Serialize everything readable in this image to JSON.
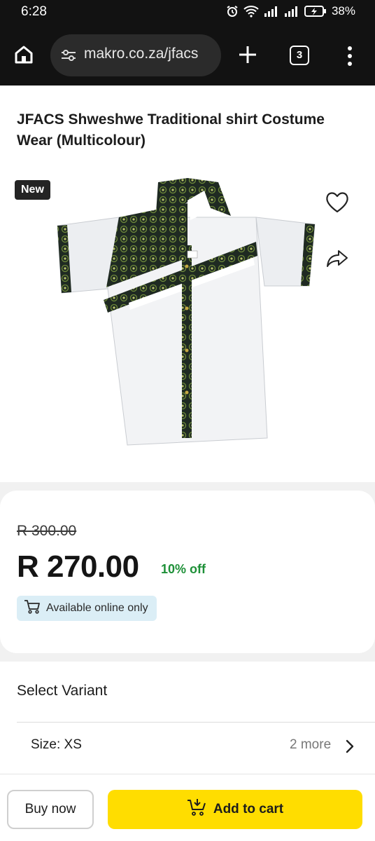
{
  "status_bar": {
    "time": "6:28",
    "battery": "38%",
    "icons": [
      "alarm-icon",
      "wifi-icon",
      "signal-icon",
      "signal-icon",
      "battery-charging-icon"
    ]
  },
  "browser": {
    "url": "makro.co.za/jfacs",
    "tab_count": "3",
    "icons": [
      "home-icon",
      "site-settings-icon",
      "plus-icon",
      "more-vertical-icon"
    ]
  },
  "product": {
    "title": "JFACS Shweshwe Traditional shirt Costume Wear (Multicolour)",
    "badge": "New",
    "old_price": "R 300.00",
    "price": "R 270.00",
    "discount": "10% off",
    "availability": "Available online only",
    "icons": [
      "heart-icon",
      "share-icon",
      "cart-icon"
    ]
  },
  "variant": {
    "heading": "Select Variant",
    "size_label": "Size: XS",
    "more_text": "2 more"
  },
  "actions": {
    "buy_now": "Buy now",
    "add_to_cart": "Add to cart"
  },
  "colors": {
    "accent_yellow": "#ffdd00",
    "discount_green": "#1e9038",
    "availability_bg": "#dbeef6"
  }
}
